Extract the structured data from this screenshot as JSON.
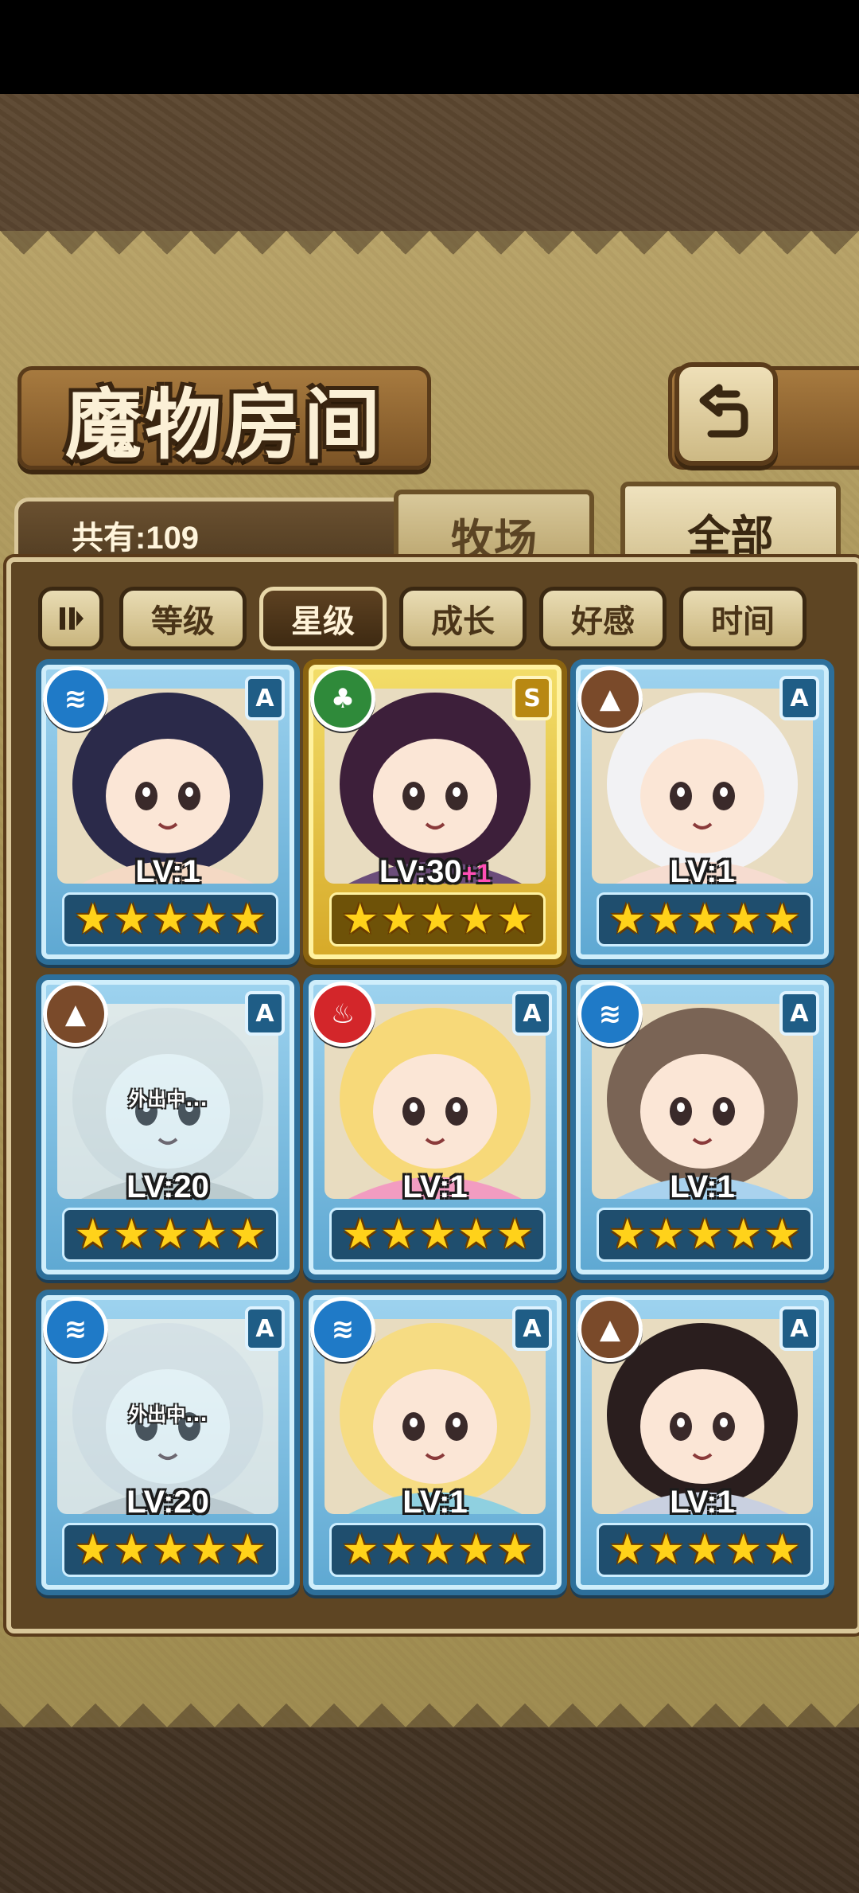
{
  "header": {
    "title": "魔物房间",
    "back_icon": "back-arrow-icon"
  },
  "summary": {
    "total_label": "共有:109"
  },
  "tabs": [
    {
      "label": "牧场",
      "active": false
    },
    {
      "label": "全部",
      "active": true
    }
  ],
  "filters": {
    "sort_icon": "sort-order-icon",
    "items": [
      {
        "label": "等级",
        "active": false
      },
      {
        "label": "星级",
        "active": true
      },
      {
        "label": "成长",
        "active": false
      },
      {
        "label": "好感",
        "active": false
      },
      {
        "label": "时间",
        "active": false
      }
    ]
  },
  "monsters": [
    {
      "element": "water",
      "element_icon": "water-element-icon",
      "rank": "A",
      "level": "LV:1",
      "plus": "",
      "away": "",
      "stars": 5,
      "frame": "blue",
      "palette": [
        "#2b2a4a",
        "#f4d9c4"
      ]
    },
    {
      "element": "wood",
      "element_icon": "wood-element-icon",
      "rank": "S",
      "level": "LV:30",
      "plus": "+1",
      "away": "",
      "stars": 5,
      "frame": "gold",
      "palette": [
        "#3d1f3a",
        "#6b4d7a"
      ]
    },
    {
      "element": "earth",
      "element_icon": "earth-element-icon",
      "rank": "A",
      "level": "LV:1",
      "plus": "",
      "away": "",
      "stars": 5,
      "frame": "blue",
      "palette": [
        "#f2f2f4",
        "#f6dcd0"
      ]
    },
    {
      "element": "earth",
      "element_icon": "earth-element-icon",
      "rank": "A",
      "level": "LV:20",
      "plus": "",
      "away": "外出中...",
      "stars": 5,
      "frame": "blue",
      "palette": [
        "#d9d2bd",
        "#c7c0a8"
      ]
    },
    {
      "element": "fire",
      "element_icon": "fire-element-icon",
      "rank": "A",
      "level": "LV:1",
      "plus": "",
      "away": "",
      "stars": 5,
      "frame": "blue",
      "palette": [
        "#f7d979",
        "#f29cc1"
      ]
    },
    {
      "element": "water",
      "element_icon": "water-element-icon",
      "rank": "A",
      "level": "LV:1",
      "plus": "",
      "away": "",
      "stars": 5,
      "frame": "blue",
      "palette": [
        "#7a6455",
        "#a9d2ee"
      ]
    },
    {
      "element": "water",
      "element_icon": "water-element-icon",
      "rank": "A",
      "level": "LV:20",
      "plus": "",
      "away": "外出中...",
      "stars": 5,
      "frame": "blue",
      "palette": [
        "#d8d3c6",
        "#c4bdb0"
      ]
    },
    {
      "element": "water",
      "element_icon": "water-element-icon",
      "rank": "A",
      "level": "LV:1",
      "plus": "",
      "away": "",
      "stars": 5,
      "frame": "blue",
      "palette": [
        "#f6dc83",
        "#8fd0e0"
      ]
    },
    {
      "element": "earth",
      "element_icon": "earth-element-icon",
      "rank": "A",
      "level": "LV:1",
      "plus": "",
      "away": "",
      "stars": 5,
      "frame": "blue",
      "palette": [
        "#2a1e1e",
        "#c9d0e0"
      ]
    }
  ]
}
